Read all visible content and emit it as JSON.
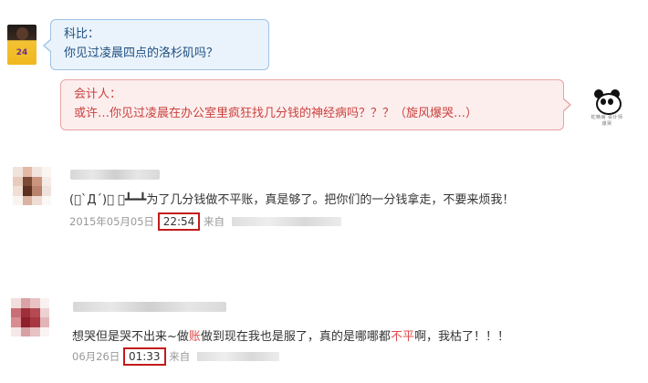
{
  "chat": {
    "question": {
      "speaker": "科比：",
      "text": "你见过凌晨四点的洛杉矶吗？",
      "jersey_number": "24"
    },
    "answer": {
      "speaker": "会计人：",
      "text": "或许…你见过凌晨在办公室里疯狂找几分钱的神经病吗？？？（旋风爆哭…）"
    },
    "panda_caption": "蛇精病 会计师爆哭"
  },
  "comments": [
    {
      "text_prefix": "(ﾟ`Д´)ﾟ ⌒┻━┻",
      "text": "为了几分钱做不平账，真是够了。把你们的一分钱拿走，不要来烦我！",
      "date": "2015年05月05日",
      "time": "22:54",
      "source_label": "来自"
    },
    {
      "text_part1": "想哭但是哭不出来~做",
      "text_red1": "账",
      "text_part2": "做到现在我也是服了，真的是哪哪都",
      "text_red2": "不平",
      "text_part3": "啊，我枯了！！！",
      "date": "06月26日",
      "time": "01:33",
      "source_label": "来自"
    }
  ],
  "colors": {
    "highlight_box": "#c21b1b",
    "blue_bubble": "#eaf3fb",
    "red_bubble": "#fdeeee"
  }
}
